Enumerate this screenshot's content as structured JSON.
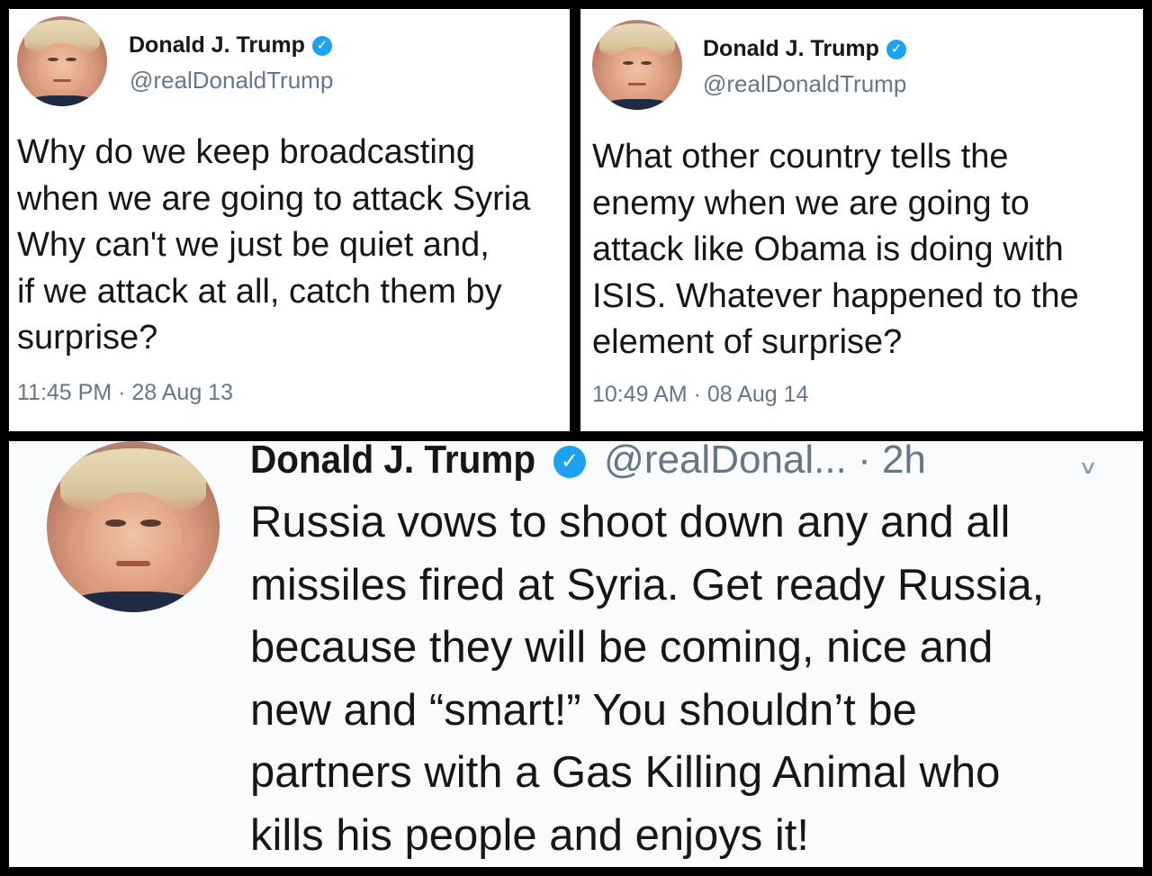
{
  "tweets": [
    {
      "name": "Donald J. Trump",
      "handle": "@realDonaldTrump",
      "lines": [
        "Why do we keep broadcasting",
        "when we are going to attack Syria",
        "Why can't we just be quiet and,",
        "if we attack at all, catch them by",
        "surprise?"
      ],
      "timestamp": "11:45 PM · 28 Aug 13"
    },
    {
      "name": "Donald J. Trump",
      "handle": "@realDonaldTrump",
      "lines": [
        "What other country tells the",
        "enemy when we are going to",
        "attack like Obama is doing with",
        "ISIS. Whatever happened to the",
        "element of surprise?"
      ],
      "timestamp": "10:49 AM · 08 Aug 14"
    },
    {
      "name": "Donald J. Trump",
      "handle": "@realDonal...",
      "time": "· 2h",
      "lines": [
        "Russia vows to shoot down any and all",
        "missiles fired at Syria. Get ready Russia,",
        "because they will be coming, nice and",
        "new and “smart!” You shouldn’t be",
        "partners with a Gas Killing Animal who",
        "kills his people and enjoys it!"
      ]
    }
  ],
  "icons": {
    "verified": "verified-badge-icon",
    "verified_glyph": "✓",
    "chevron": "chevron-down-icon",
    "chevron_glyph": "∨"
  },
  "colors": {
    "verified_blue": "#1da1f2",
    "secondary_text": "#657786",
    "primary_text": "#14171a"
  }
}
